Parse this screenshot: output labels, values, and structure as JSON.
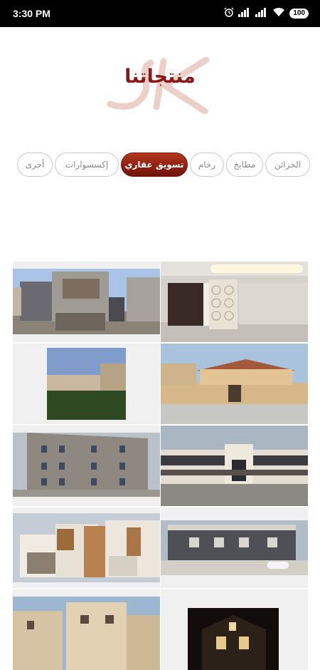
{
  "status": {
    "time": "3:30 PM",
    "battery": "100"
  },
  "header": {
    "title": "منتجاتنا"
  },
  "tabs": [
    {
      "label": "الخزائن",
      "active": false
    },
    {
      "label": "مطابخ",
      "active": false
    },
    {
      "label": "رخام",
      "active": false
    },
    {
      "label": "تسويق عقاري",
      "active": true
    },
    {
      "label": "إكسسوارات",
      "active": false
    },
    {
      "label": "أخرى",
      "active": false
    }
  ],
  "colors": {
    "accent": "#8a1717",
    "active_tab": "#9b2512"
  },
  "gallery": [
    {
      "name": "property-photo-1"
    },
    {
      "name": "property-photo-2"
    },
    {
      "name": "property-photo-3"
    },
    {
      "name": "property-photo-4"
    },
    {
      "name": "property-photo-5"
    },
    {
      "name": "property-photo-6"
    },
    {
      "name": "property-photo-7"
    },
    {
      "name": "property-photo-8"
    },
    {
      "name": "property-photo-9"
    },
    {
      "name": "property-photo-10"
    }
  ]
}
